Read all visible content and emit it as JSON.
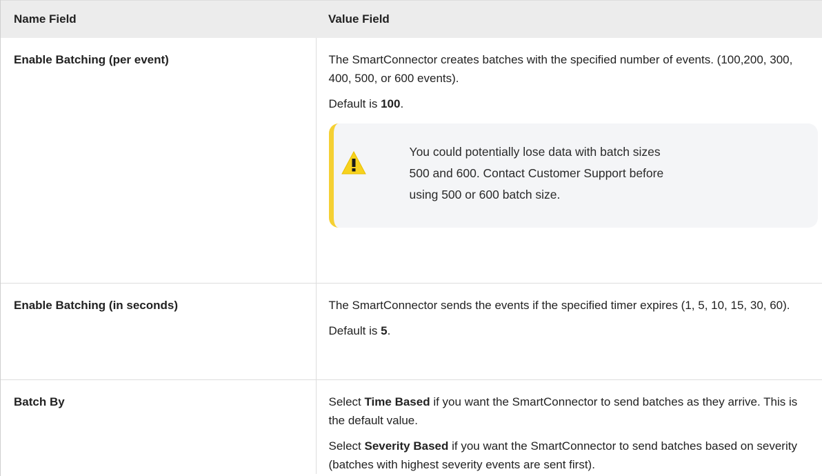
{
  "header": {
    "name_col": "Name Field",
    "value_col": "Value Field"
  },
  "rows": [
    {
      "name": "Enable Batching (per event)",
      "desc": "The SmartConnector creates batches with the specified number of events. (100,200, 300, 400, 500, or 600 events).",
      "default_prefix": "Default is ",
      "default_value": "100",
      "default_suffix": ".",
      "note": {
        "icon": "warning-icon",
        "lines": [
          "You could potentially lose data with batch sizes",
          "500 and 600. Contact Customer Support before",
          "using 500 or 600 batch size."
        ]
      }
    },
    {
      "name": "Enable Batching (in seconds)",
      "desc": "The SmartConnector sends the events if the specified timer expires (1, 5, 10, 15, 30, 60).",
      "default_prefix": "Default is ",
      "default_value": "5",
      "default_suffix": "."
    },
    {
      "name": "Batch By",
      "p1_prefix": "Select ",
      "p1_bold": "Time Based",
      "p1_suffix": " if you want the SmartConnector to send batches as they arrive. This is the default value.",
      "p2_prefix": "Select ",
      "p2_bold": "Severity Based",
      "p2_suffix": " if you want the SmartConnector to send batches based on severity (batches with highest severity events are sent first)."
    }
  ],
  "colors": {
    "header_bg": "#ececec",
    "note_bg": "#f4f5f7",
    "note_accent": "#f5d033"
  }
}
